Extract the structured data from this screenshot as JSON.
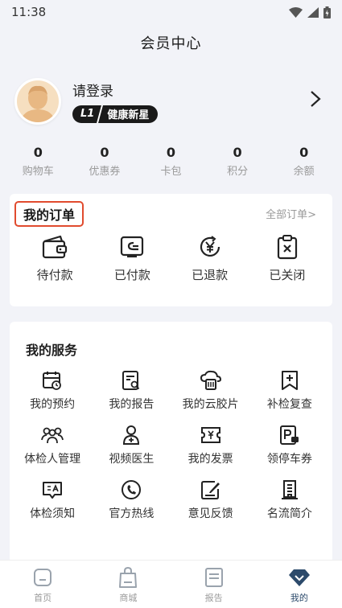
{
  "status_bar": {
    "time": "11:38"
  },
  "header": {
    "title": "会员中心"
  },
  "profile": {
    "login_text": "请登录",
    "level": "L1",
    "level_name": "健康新星"
  },
  "stats": [
    {
      "value": "0",
      "label": "购物车"
    },
    {
      "value": "0",
      "label": "优惠券"
    },
    {
      "value": "0",
      "label": "卡包"
    },
    {
      "value": "0",
      "label": "积分"
    },
    {
      "value": "0",
      "label": "余额"
    }
  ],
  "orders": {
    "title": "我的订单",
    "all_link": "全部订单>",
    "items": [
      {
        "label": "待付款",
        "icon": "wallet-icon"
      },
      {
        "label": "已付款",
        "icon": "paid-card-icon"
      },
      {
        "label": "已退款",
        "icon": "refund-yen-icon"
      },
      {
        "label": "已关闭",
        "icon": "closed-clipboard-icon"
      }
    ]
  },
  "services": {
    "title": "我的服务",
    "items": [
      {
        "label": "我的预约",
        "icon": "calendar-clock-icon"
      },
      {
        "label": "我的报告",
        "icon": "report-search-icon"
      },
      {
        "label": "我的云胶片",
        "icon": "cloud-film-icon"
      },
      {
        "label": "补检复查",
        "icon": "bookmark-plus-icon"
      },
      {
        "label": "体检人管理",
        "icon": "people-group-icon"
      },
      {
        "label": "视频医生",
        "icon": "video-doctor-icon"
      },
      {
        "label": "我的发票",
        "icon": "invoice-icon"
      },
      {
        "label": "领停车券",
        "icon": "parking-ticket-icon"
      },
      {
        "label": "体检须知",
        "icon": "notice-message-icon"
      },
      {
        "label": "官方热线",
        "icon": "phone-hotline-icon"
      },
      {
        "label": "意见反馈",
        "icon": "feedback-edit-icon"
      },
      {
        "label": "名流简介",
        "icon": "building-icon"
      }
    ]
  },
  "tabs": [
    {
      "label": "首页",
      "icon": "home-icon"
    },
    {
      "label": "商城",
      "icon": "shopping-bag-icon"
    },
    {
      "label": "报告",
      "icon": "report-icon"
    },
    {
      "label": "我的",
      "icon": "diamond-icon"
    }
  ],
  "colors": {
    "accent": "#2c4a6b",
    "highlight_border": "#e14b2e",
    "background": "#f2f3f8"
  }
}
